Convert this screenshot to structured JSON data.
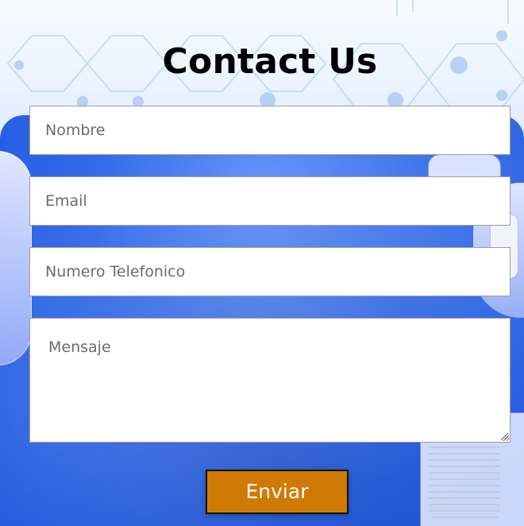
{
  "page": {
    "title": "Contact Us"
  },
  "form": {
    "nombre": {
      "placeholder": "Nombre",
      "value": ""
    },
    "email": {
      "placeholder": "Email",
      "value": ""
    },
    "telefono": {
      "placeholder": "Numero Telefonico",
      "value": ""
    },
    "mensaje": {
      "placeholder": "Mensaje",
      "value": ""
    },
    "submit_label": "Enviar"
  },
  "colors": {
    "title": "#000000",
    "button_bg": "#d07a06",
    "button_text": "#ffffff",
    "input_border": "#505050"
  },
  "icons": {
    "textarea_resize": "resize-grip-icon"
  }
}
